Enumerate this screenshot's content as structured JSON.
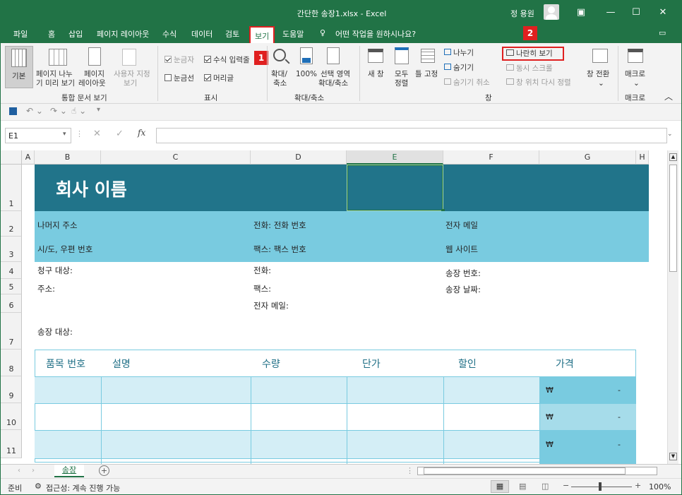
{
  "window": {
    "title": "간단한 송장1.xlsx - Excel",
    "user": "정 용원"
  },
  "tabs": [
    "파일",
    "홈",
    "삽입",
    "페이지 레이아웃",
    "수식",
    "데이터",
    "검토",
    "보기",
    "도움말"
  ],
  "tellme": "어떤 작업을 원하시나요?",
  "ribbon": {
    "groups": {
      "views": "통합 문서 보기",
      "show": "표시",
      "zoom": "확대/축소",
      "window": "창",
      "macros": "매크로"
    },
    "views": {
      "normal": "기본",
      "pagebreak1": "페이지 나누",
      "pagebreak2": "기 미리 보기",
      "layout1": "페이지",
      "layout2": "레이아웃",
      "custom1": "사용자 지정",
      "custom2": "보기"
    },
    "show": {
      "ruler": "눈금자",
      "formula": "수식 입력줄",
      "gridlines": "눈금선",
      "headings": "머리글"
    },
    "zoom": {
      "zoom1": "확대/",
      "zoom2": "축소",
      "hundred": "100%",
      "sel1": "선택 영역",
      "sel2": "확대/축소"
    },
    "window": {
      "newwin": "새 창",
      "arrange1": "모두",
      "arrange2": "정렬",
      "freeze": "틀 고정",
      "split": "나누기",
      "hide": "숨기기",
      "unhide": "숨기기 취소",
      "sidebyside": "나란히 보기",
      "sync": "동시 스크롤",
      "reset": "창 위치 다시 정렬",
      "switch": "창 전환"
    },
    "macros": {
      "label": "매크로"
    }
  },
  "badges": [
    "1",
    "2"
  ],
  "formula_bar": {
    "namebox": "E1",
    "fx": "fx"
  },
  "columns": [
    "A",
    "B",
    "C",
    "D",
    "E",
    "F",
    "G",
    "H"
  ],
  "rows": [
    "1",
    "2",
    "3",
    "4",
    "5",
    "6",
    "7",
    "8",
    "9",
    "10",
    "11"
  ],
  "sheet": {
    "company": "회사 이름",
    "address": "나머지 주소",
    "city": "시/도, 우편 번호",
    "phone": "전화: 전화 번호",
    "fax": "팩스: 팩스 번호",
    "email": "전자 메일",
    "web": "웹 사이트",
    "bill_to": "청구 대상:",
    "addr_lbl": "주소:",
    "ship_to": "송장 대상:",
    "tel_lbl": "전화:",
    "fax_lbl": "팩스:",
    "email_lbl": "전자 메일:",
    "inv_no": "송장 번호:",
    "inv_date": "송장 날짜:",
    "headers": [
      "품목 번호",
      "설명",
      "수량",
      "단가",
      "할인",
      "가격"
    ],
    "currency": "₩",
    "dash": "-"
  },
  "sheet_tab": "송장",
  "status": {
    "ready": "준비",
    "access": "접근성: 계속 진행 가능",
    "zoom": "100%"
  },
  "colors": {
    "brand": "#217346",
    "header_dark": "#21748a",
    "header_light": "#79cbe0",
    "row_light": "#d4eef6",
    "price_dark": "#79cbe0"
  }
}
